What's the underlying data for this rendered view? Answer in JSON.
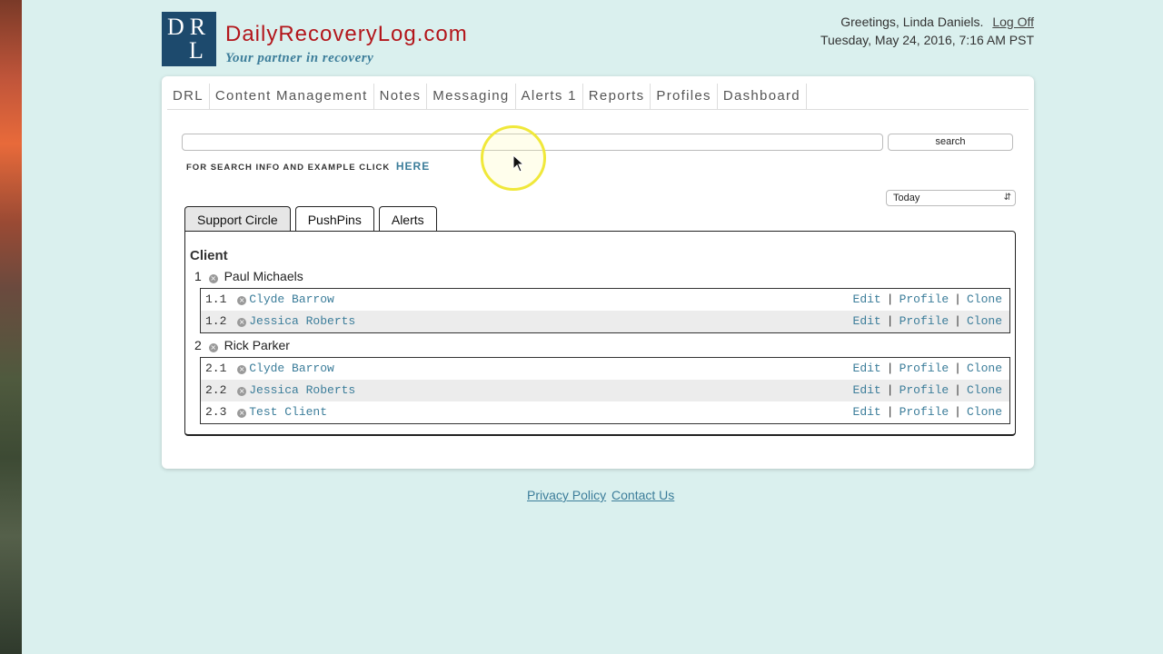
{
  "brand": {
    "logo_line1": "DR",
    "logo_line2": "L",
    "site_name": "DailyRecoveryLog.com",
    "tagline": "Your partner in recovery",
    "colors": {
      "primary": "#1d4a6d",
      "accent_red": "#b3161b",
      "link": "#3c7d9a",
      "page_bg": "#daf0ee"
    }
  },
  "user": {
    "greeting": "Greetings, Linda Daniels.",
    "logoff_label": "Log Off",
    "date_time": "Tuesday, May 24, 2016, 7:16 AM PST"
  },
  "nav": [
    {
      "label": "DRL"
    },
    {
      "label": "Content Management"
    },
    {
      "label": "Notes"
    },
    {
      "label": "Messaging"
    },
    {
      "label": "Alerts 1"
    },
    {
      "label": "Reports"
    },
    {
      "label": "Profiles"
    },
    {
      "label": "Dashboard"
    }
  ],
  "search": {
    "value": "",
    "button_label": "search",
    "info_text": "FOR SEARCH INFO AND EXAMPLE CLICK",
    "info_link": "HERE"
  },
  "period": {
    "selected": "Today",
    "arrow_icon": "updown-arrows-icon"
  },
  "tabs": [
    {
      "label": "Support Circle",
      "active": true
    },
    {
      "label": "PushPins",
      "active": false
    },
    {
      "label": "Alerts",
      "active": false
    }
  ],
  "panel": {
    "heading": "Client",
    "clients": [
      {
        "num": "1",
        "name": "Paul Michaels",
        "members": [
          {
            "num": "1.1",
            "name": "Clyde Barrow"
          },
          {
            "num": "1.2",
            "name": "Jessica Roberts"
          }
        ]
      },
      {
        "num": "2",
        "name": "Rick Parker",
        "members": [
          {
            "num": "2.1",
            "name": "Clyde Barrow"
          },
          {
            "num": "2.2",
            "name": "Jessica Roberts"
          },
          {
            "num": "2.3",
            "name": "Test Client"
          }
        ]
      }
    ],
    "actions": {
      "edit": "Edit",
      "profile": "Profile",
      "clone": "Clone",
      "separator": "|"
    },
    "remove_icon": "remove-circle-icon"
  },
  "footer": {
    "privacy": "Privacy Policy",
    "contact": "Contact Us"
  }
}
